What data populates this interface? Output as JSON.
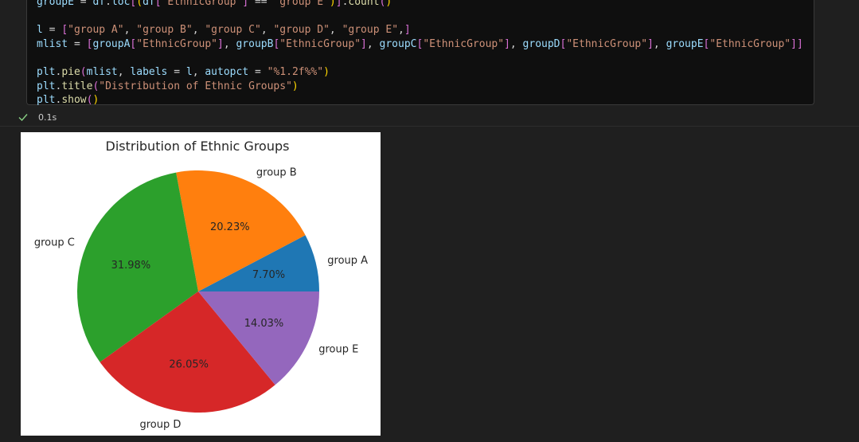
{
  "code": {
    "lines": [
      "groupE = df.loc[(df[\"EthnicGroup\"] == \"group E\")].count()",
      "",
      "l = [\"group A\", \"group B\", \"group C\", \"group D\", \"group E\",]",
      "mlist = [groupA[\"EthnicGroup\"], groupB[\"EthnicGroup\"], groupC[\"EthnicGroup\"], groupD[\"EthnicGroup\"], groupE[\"EthnicGroup\"]]",
      "",
      "plt.pie(mlist, labels = l, autopct = \"%1.2f%%\")",
      "plt.title(\"Distribution of Ethnic Groups\")",
      "plt.show()"
    ]
  },
  "status": {
    "icon": "check-icon",
    "duration": "0.1s",
    "color": "#89d185"
  },
  "chart_data": {
    "type": "pie",
    "title": "Distribution of Ethnic Groups",
    "labels": [
      "group A",
      "group B",
      "group C",
      "group D",
      "group E"
    ],
    "values": [
      7.7,
      20.23,
      31.98,
      26.05,
      14.03
    ],
    "value_labels": [
      "7.70%",
      "20.23%",
      "31.98%",
      "26.05%",
      "14.03%"
    ],
    "colors": [
      "#1f77b4",
      "#ff7f0e",
      "#2ca02c",
      "#d62728",
      "#9467bd"
    ],
    "start_angle_deg": 0,
    "direction": "counterclockwise"
  }
}
